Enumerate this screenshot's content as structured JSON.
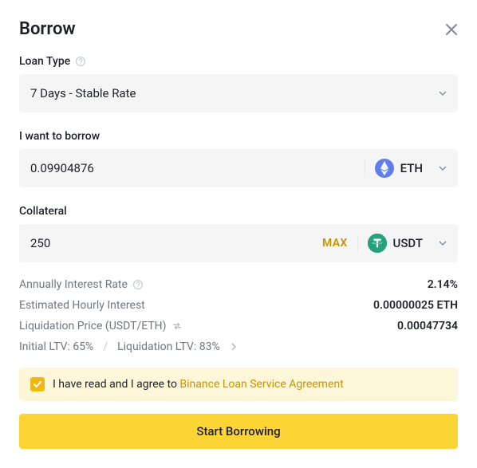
{
  "header": {
    "title": "Borrow"
  },
  "loanType": {
    "label": "Loan Type",
    "value": "7 Days - Stable Rate"
  },
  "borrow": {
    "label": "I want to borrow",
    "value": "0.09904876",
    "currency": "ETH"
  },
  "collateral": {
    "label": "Collateral",
    "value": "250",
    "max_label": "MAX",
    "currency": "USDT"
  },
  "info": {
    "annual_rate_label": "Annually Interest Rate",
    "annual_rate_value": "2.14%",
    "hourly_label": "Estimated Hourly Interest",
    "hourly_value": "0.00000025 ETH",
    "liq_price_label": "Liquidation Price (USDT/ETH)",
    "liq_price_value": "0.00047734"
  },
  "ltv": {
    "initial": "Initial LTV: 65%",
    "liquidation": "Liquidation LTV: 83%"
  },
  "agreement": {
    "text": "I have read and I agree to ",
    "link": "Binance Loan Service Agreement"
  },
  "cta": {
    "start": "Start Borrowing"
  }
}
